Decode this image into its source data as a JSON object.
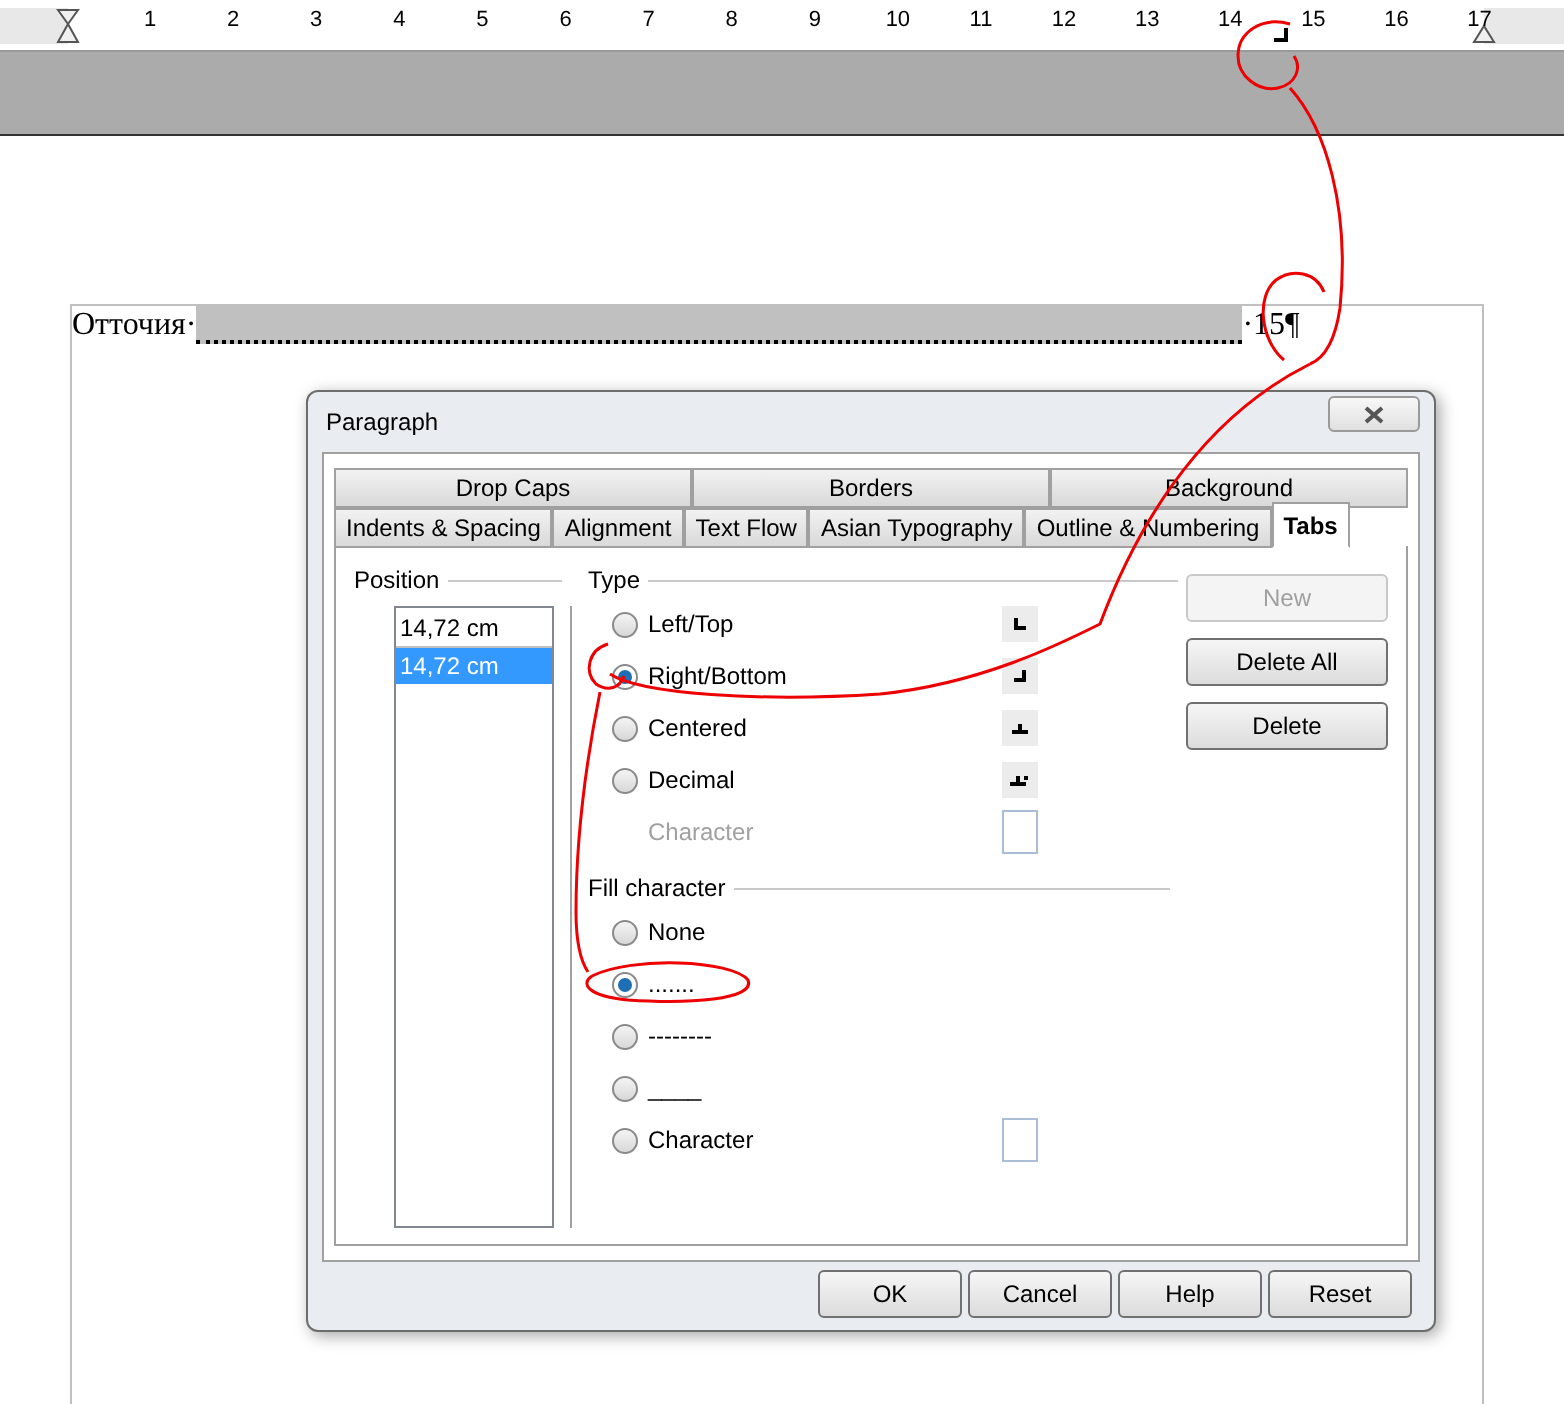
{
  "ruler": {
    "labels": [
      "1",
      "2",
      "3",
      "4",
      "5",
      "6",
      "7",
      "8",
      "9",
      "10",
      "11",
      "12",
      "13",
      "14",
      "15",
      "16",
      "17"
    ]
  },
  "document": {
    "text": "Отточия·",
    "tail": "·15¶"
  },
  "dialog": {
    "title": "Paragraph",
    "tab_rows": [
      [
        {
          "label": "Drop Caps",
          "selected": false
        },
        {
          "label": "Borders",
          "selected": false
        },
        {
          "label": "Background",
          "selected": false
        }
      ],
      [
        {
          "label": "Indents & Spacing",
          "selected": false
        },
        {
          "label": "Alignment",
          "selected": false
        },
        {
          "label": "Text Flow",
          "selected": false
        },
        {
          "label": "Asian Typography",
          "selected": false
        },
        {
          "label": "Outline & Numbering",
          "selected": false
        },
        {
          "label": "Tabs",
          "selected": true
        }
      ]
    ],
    "position": {
      "label": "Position",
      "value": "14,72 cm",
      "items": [
        {
          "text": "14,72 cm",
          "selected": true
        }
      ]
    },
    "type": {
      "label": "Type",
      "options": [
        {
          "kind": "left",
          "label": "Left/Top",
          "selected": false,
          "disabled": false
        },
        {
          "kind": "right",
          "label": "Right/Bottom",
          "selected": true,
          "disabled": false
        },
        {
          "kind": "center",
          "label": "Centered",
          "selected": false,
          "disabled": false
        },
        {
          "kind": "decimal",
          "label": "Decimal",
          "selected": false,
          "disabled": false
        },
        {
          "kind": "character",
          "label": "Character",
          "disabled": true
        }
      ]
    },
    "fill": {
      "label": "Fill character",
      "options": [
        {
          "kind": "radio",
          "label": "None",
          "selected": false
        },
        {
          "kind": "radio",
          "label": ".......",
          "selected": true
        },
        {
          "kind": "radio",
          "label": "--------",
          "selected": false
        },
        {
          "kind": "radio",
          "label": "____",
          "selected": false
        },
        {
          "kind": "character",
          "label": "Character",
          "selected": false
        }
      ]
    },
    "side_buttons": [
      {
        "label": "New",
        "disabled": true
      },
      {
        "label": "Delete All",
        "disabled": false
      },
      {
        "label": "Delete",
        "disabled": false
      }
    ],
    "buttons": [
      "OK",
      "Cancel",
      "Help",
      "Reset"
    ]
  }
}
